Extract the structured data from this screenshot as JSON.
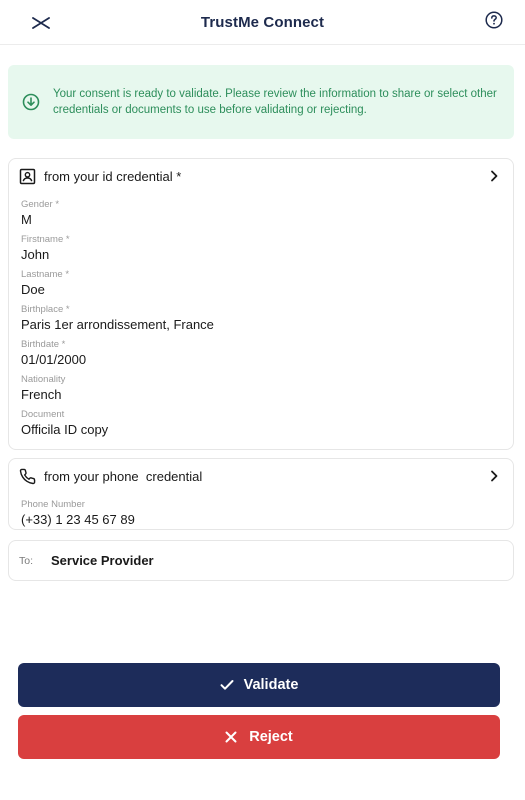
{
  "header": {
    "title": "TrustMe Connect",
    "close_icon": "close-icon",
    "help_icon": "help-icon"
  },
  "banner": {
    "icon": "download-circle-icon",
    "message": "Your consent is ready to validate. Please review the information to share or select other credentials or documents to use before validating or rejecting."
  },
  "id_credential": {
    "icon": "id-card-icon",
    "title": "from your id credential *",
    "fields": [
      {
        "label": "Gender *",
        "value": "M"
      },
      {
        "label": "Firstname *",
        "value": "John"
      },
      {
        "label": "Lastname *",
        "value": "Doe"
      },
      {
        "label": "Birthplace *",
        "value": "Paris 1er arrondissement, France"
      },
      {
        "label": "Birthdate *",
        "value": "01/01/2000"
      },
      {
        "label": "Nationality",
        "value": "French"
      },
      {
        "label": "Document",
        "value": "Officila ID copy"
      }
    ]
  },
  "phone_credential": {
    "icon": "phone-icon",
    "title": "from your phone  credential",
    "fields": [
      {
        "label": "Phone Number",
        "value": "(+33) 1 23 45 67 89"
      }
    ]
  },
  "recipient": {
    "label": "To:",
    "value": "Service Provider"
  },
  "actions": {
    "validate_label": "Validate",
    "reject_label": "Reject"
  },
  "colors": {
    "primary": "#1d2c5a",
    "danger": "#d93f3f",
    "success_bg": "#e7f8ee",
    "success_text": "#2d8e5b"
  }
}
